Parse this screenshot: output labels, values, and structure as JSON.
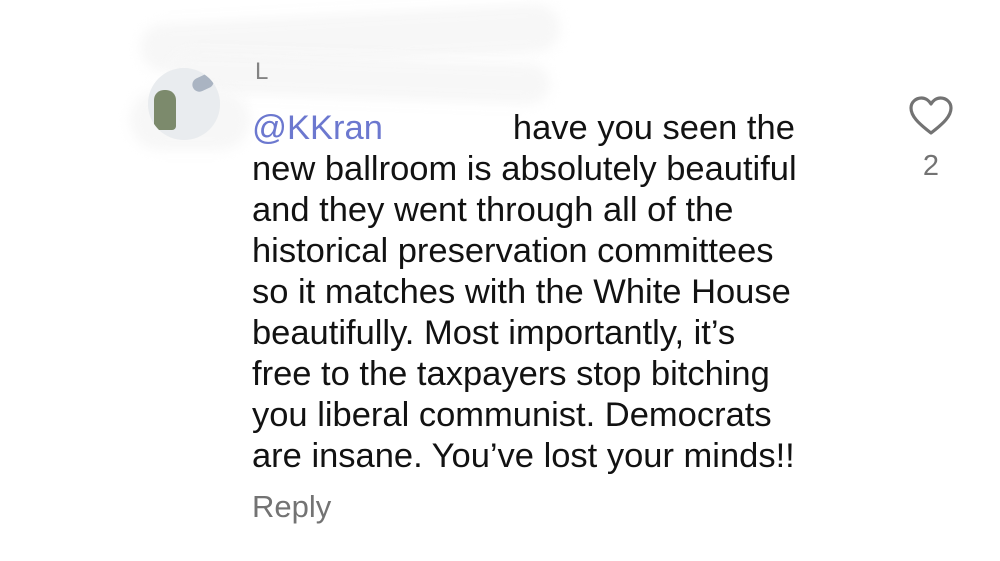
{
  "comment": {
    "username": "L",
    "mention": "@KKran",
    "text_first_line_rest": "have you seen the",
    "text_remaining": "new ballroom is absolutely beautiful\nand they went through all of the\nhistorical preservation committees\nso it matches with the White House\nbeautifully. Most importantly, it’s\nfree to the taxpayers stop bitching\nyou liberal communist. Democrats\nare insane. You’ve lost your minds!!",
    "reply_label": "Reply",
    "like_count": "2",
    "like_icon": "heart-outline-icon"
  },
  "colors": {
    "text": "#121212",
    "muted": "#737373",
    "mention": "#3b4cc0"
  }
}
